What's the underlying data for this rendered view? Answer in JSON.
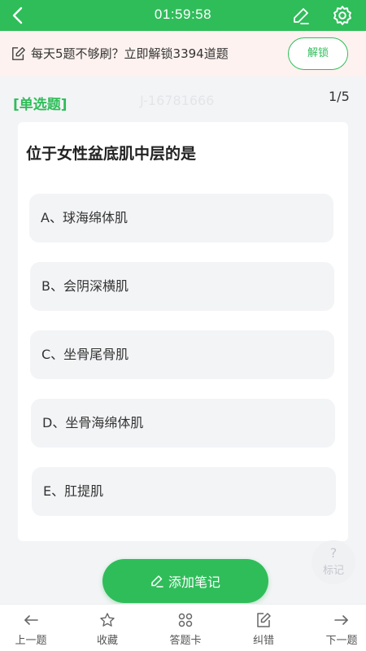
{
  "topbar": {
    "timer": "01:59:58",
    "back_icon": "chevron-left-icon",
    "edit_icon": "pencil-icon",
    "settings_icon": "gear-icon",
    "color": "#2fbd5a"
  },
  "banner": {
    "text": "每天5题不够刷？立即解锁3394道题",
    "button_label": "解锁",
    "icon": "note-edit-icon"
  },
  "question": {
    "type": "[单选题]",
    "id": "J-16781666",
    "counter": "1/5",
    "text": "位于女性盆底肌中层的是",
    "options": [
      "A、球海绵体肌",
      "B、会阴深横肌",
      "C、坐骨尾骨肌",
      "D、坐骨海绵体肌",
      "E、肛提肌"
    ]
  },
  "help": {
    "symbol": "?",
    "label": "标记"
  },
  "add_note": {
    "label": "添加笔记",
    "icon": "pencil-icon"
  },
  "bottom_nav": {
    "items": [
      {
        "label": "上一题",
        "icon": "arrow-left-icon"
      },
      {
        "label": "收藏",
        "icon": "star-icon"
      },
      {
        "label": "答题卡",
        "icon": "grid-icon"
      },
      {
        "label": "纠错",
        "icon": "edit-square-icon"
      },
      {
        "label": "下一题",
        "icon": "arrow-right-icon"
      }
    ]
  }
}
